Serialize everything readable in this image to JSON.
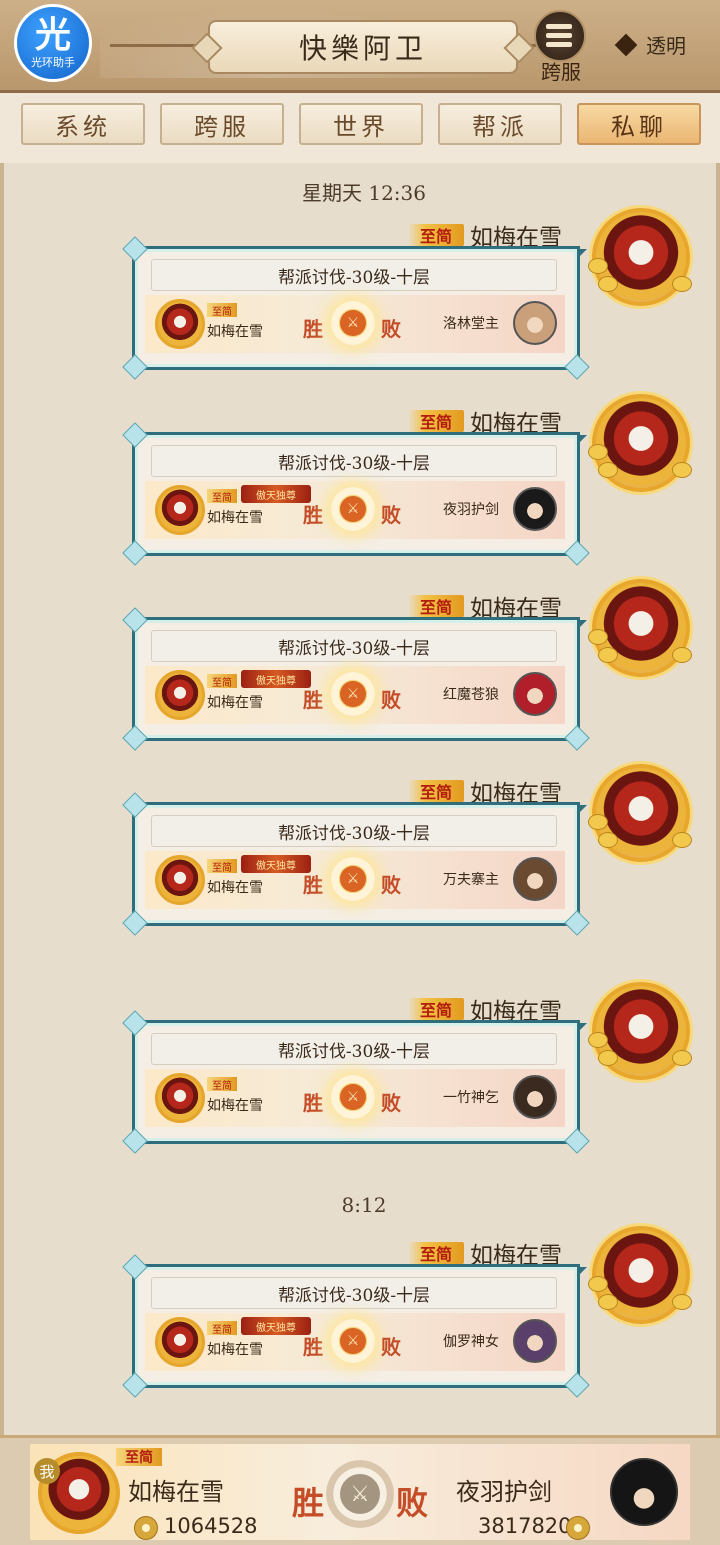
{
  "header": {
    "logo_big": "光",
    "logo_small": "光环助手",
    "title": "快樂阿卫",
    "cross_server_label": "跨服",
    "transparent_label": "透明"
  },
  "tabs": [
    {
      "label": "系统",
      "active": false
    },
    {
      "label": "跨服",
      "active": false
    },
    {
      "label": "世界",
      "active": false
    },
    {
      "label": "帮派",
      "active": false
    },
    {
      "label": "私聊",
      "active": true
    }
  ],
  "timestamps": {
    "first": "星期天 12:36",
    "second": "8:12"
  },
  "messages": [
    {
      "sender": "如梅在雪",
      "vip": "至简",
      "title": "帮派讨伐-30级-十层",
      "player": "如梅在雪",
      "player_vip": "至简",
      "honor": "",
      "win": "胜",
      "lose": "败",
      "opponent": "洛林堂主",
      "opp_color": "#c9a07a"
    },
    {
      "sender": "如梅在雪",
      "vip": "至简",
      "title": "帮派讨伐-30级-十层",
      "player": "如梅在雪",
      "player_vip": "至简",
      "honor": "傲天独尊",
      "win": "胜",
      "lose": "败",
      "opponent": "夜羽护剑",
      "opp_color": "#1a1a1a"
    },
    {
      "sender": "如梅在雪",
      "vip": "至简",
      "title": "帮派讨伐-30级-十层",
      "player": "如梅在雪",
      "player_vip": "至简",
      "honor": "傲天独尊",
      "win": "胜",
      "lose": "败",
      "opponent": "红魔苍狼",
      "opp_color": "#b01f2a"
    },
    {
      "sender": "如梅在雪",
      "vip": "至简",
      "title": "帮派讨伐-30级-十层",
      "player": "如梅在雪",
      "player_vip": "至简",
      "honor": "傲天独尊",
      "win": "胜",
      "lose": "败",
      "opponent": "万夫寨主",
      "opp_color": "#6b4a32"
    },
    {
      "sender": "如梅在雪",
      "vip": "至简",
      "title": "帮派讨伐-30级-十层",
      "player": "如梅在雪",
      "player_vip": "至简",
      "honor": "",
      "win": "胜",
      "lose": "败",
      "opponent": "一竹神乞",
      "opp_color": "#3b2a20"
    },
    {
      "sender": "如梅在雪",
      "vip": "至简",
      "title": "帮派讨伐-30级-十层",
      "player": "如梅在雪",
      "player_vip": "至简",
      "honor": "傲天独尊",
      "win": "胜",
      "lose": "败",
      "opponent": "伽罗神女",
      "opp_color": "#5a3f6a"
    }
  ],
  "footer": {
    "me_badge": "我",
    "vip": "至简",
    "player_name": "如梅在雪",
    "player_score": "1064528",
    "win": "胜",
    "lose": "败",
    "opponent_name": "夜羽护剑",
    "opponent_score": "3817820"
  }
}
